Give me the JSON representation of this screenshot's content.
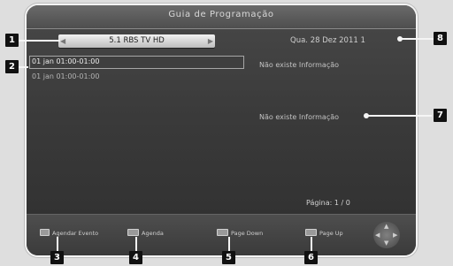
{
  "window": {
    "title": "Guia de Programação"
  },
  "channel": {
    "name": "5.1 RBS TV HD",
    "left_arrow": "◀",
    "right_arrow": "▶"
  },
  "date": "Qua.  28 Dez 2011 1",
  "events": [
    {
      "time": "01 jan 01:00-01:00"
    },
    {
      "time": "01 jan 01:00-01:00"
    }
  ],
  "info": {
    "line1": "Não existe Informação",
    "line2": "Não existe Informação"
  },
  "page_indicator": "Página: 1 / 0",
  "footer": {
    "hints": [
      {
        "label": "Agendar Evento",
        "key_icon": "ok-key-icon"
      },
      {
        "label": "Agenda",
        "key_icon": "timer-key-icon"
      },
      {
        "label": "Page Down",
        "key_icon": "page-down-key-icon"
      },
      {
        "label": "Page Up",
        "key_icon": "page-up-key-icon"
      }
    ],
    "nav_icon": "navigation-cross-icon"
  },
  "callouts": [
    "1",
    "2",
    "3",
    "4",
    "5",
    "6",
    "7",
    "8"
  ],
  "colors": {
    "screen_background": "#3a3a3a",
    "title_bar": "#5a5a5a",
    "callout_badge": "#111111",
    "page_background": "#dedede"
  }
}
